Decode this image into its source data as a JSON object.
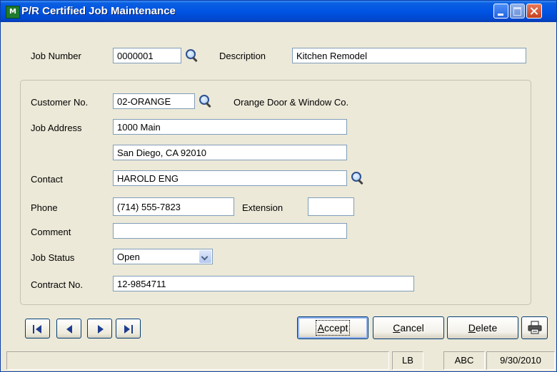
{
  "window": {
    "title": "P/R Certified Job Maintenance",
    "app_icon_text": "M"
  },
  "header": {
    "job_number_label": "Job Number",
    "job_number_value": "0000001",
    "description_label": "Description",
    "description_value": "Kitchen Remodel"
  },
  "form": {
    "customer_label": "Customer No.",
    "customer_value": "02-ORANGE",
    "customer_name": "Orange Door & Window Co.",
    "job_address_label": "Job Address",
    "address_line1": "1000 Main",
    "address_line2": "San Diego, CA 92010",
    "contact_label": "Contact",
    "contact_value": "HAROLD ENG",
    "phone_label": "Phone",
    "phone_value": "(714) 555-7823",
    "extension_label": "Extension",
    "extension_value": "",
    "comment_label": "Comment",
    "comment_value": "",
    "job_status_label": "Job Status",
    "job_status_value": "Open",
    "contract_label": "Contract No.",
    "contract_value": "12-9854711"
  },
  "buttons": {
    "accept_first": "A",
    "accept_rest": "ccept",
    "cancel_first": "C",
    "cancel_rest": "ancel",
    "delete_first": "D",
    "delete_rest": "elete"
  },
  "icons": {
    "lookup": "magnifier-icon",
    "nav_first": "first-record-icon",
    "nav_prev": "previous-record-icon",
    "nav_next": "next-record-icon",
    "nav_last": "last-record-icon",
    "print": "printer-icon"
  },
  "status": {
    "user": "LB",
    "company": "ABC",
    "date": "9/30/2010"
  }
}
